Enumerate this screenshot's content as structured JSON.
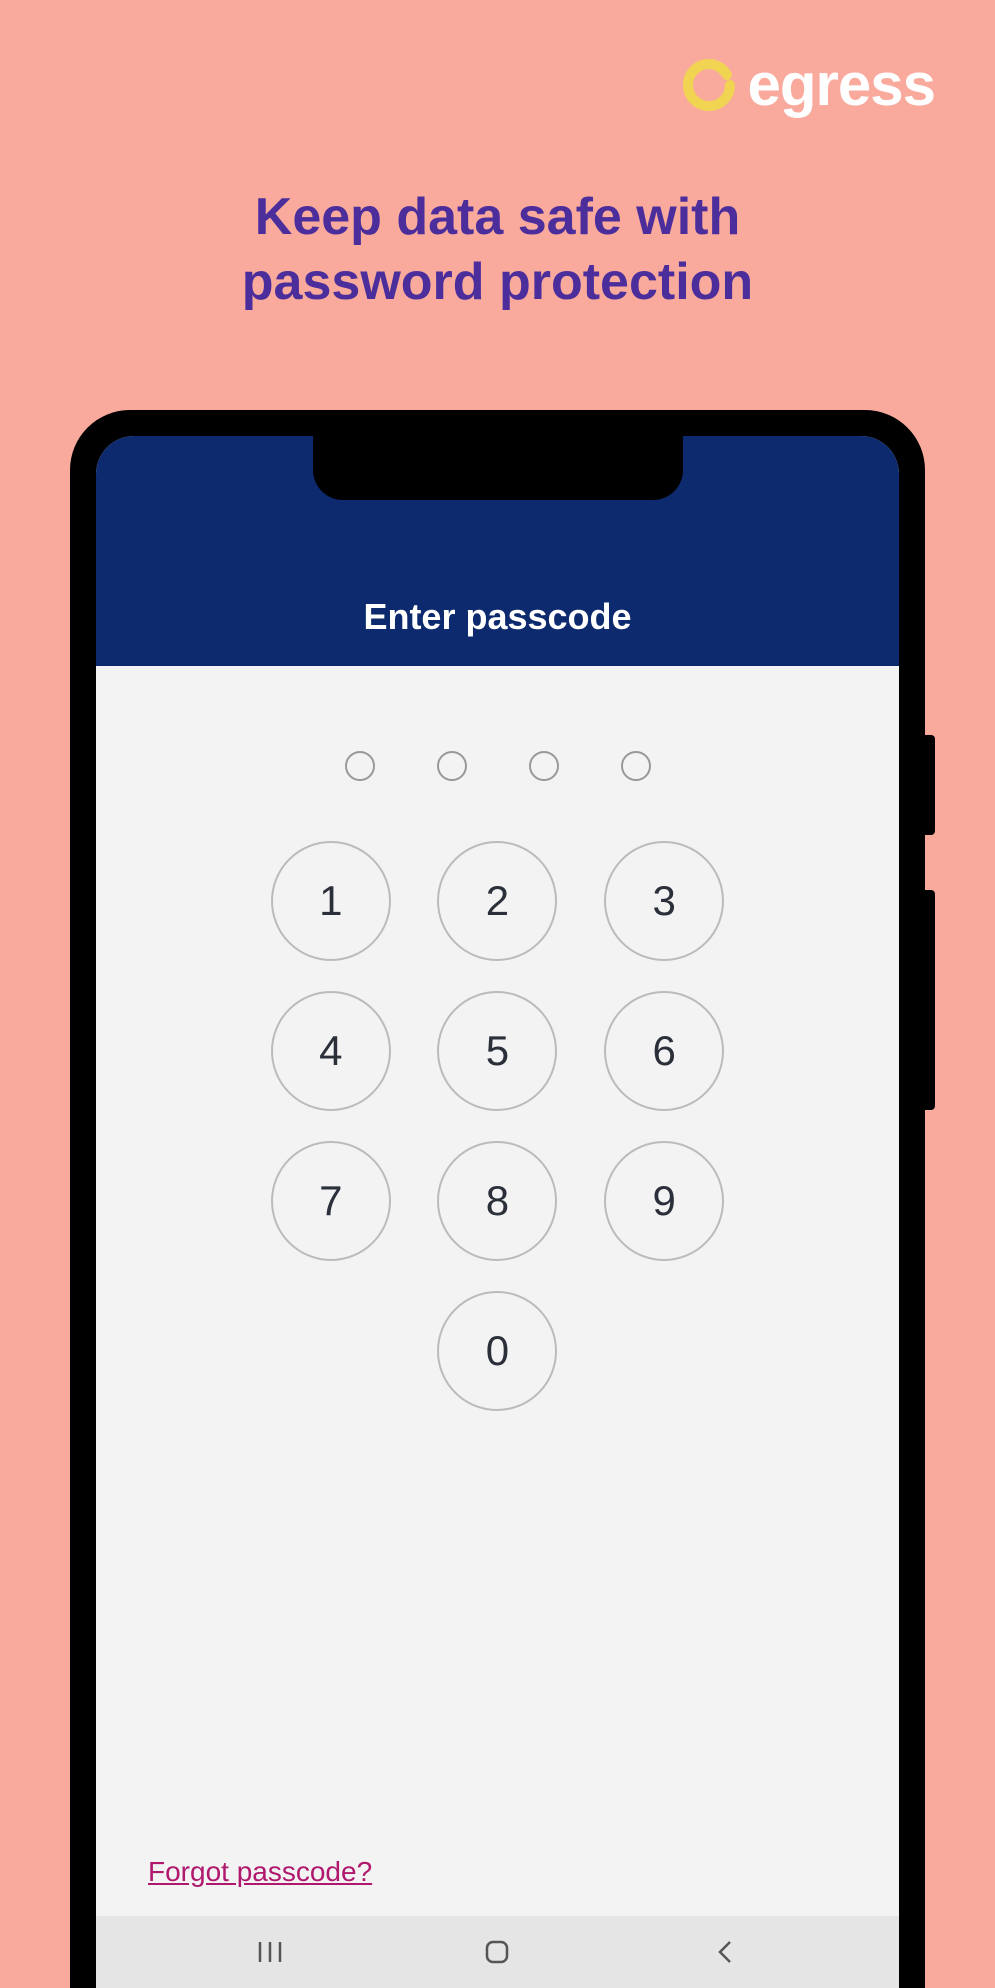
{
  "brand": {
    "name": "egress"
  },
  "headline_line1": "Keep data safe with",
  "headline_line2": "password protection",
  "screen": {
    "title": "Enter passcode",
    "forgot_link": "Forgot passcode?"
  },
  "keypad": {
    "k1": "1",
    "k2": "2",
    "k3": "3",
    "k4": "4",
    "k5": "5",
    "k6": "6",
    "k7": "7",
    "k8": "8",
    "k9": "9",
    "k0": "0"
  }
}
